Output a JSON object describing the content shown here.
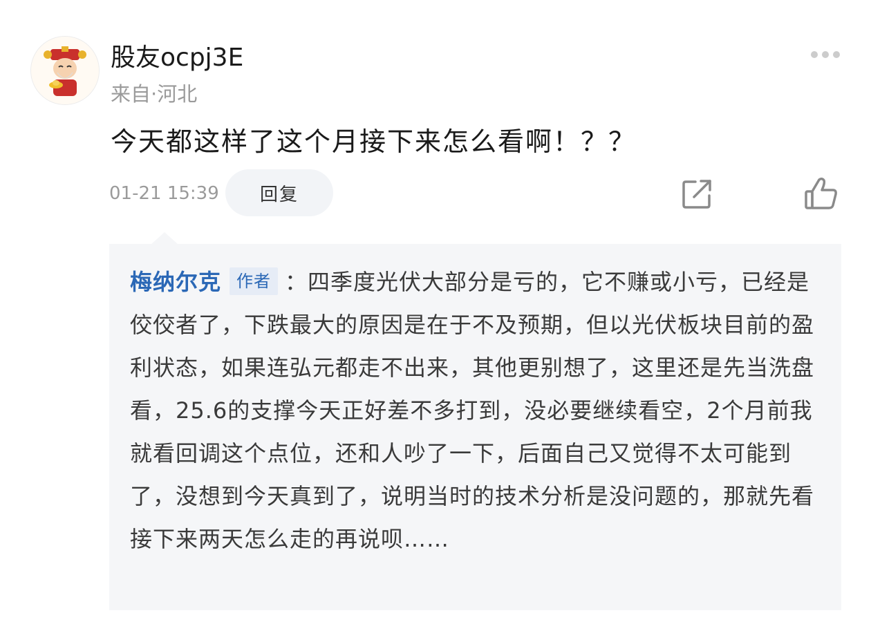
{
  "post": {
    "username": "股友ocpj3E",
    "location": "来自·河北",
    "text": "今天都这样了这个月接下来怎么看啊！？？",
    "timestamp": "01-21 15:39",
    "reply_label": "回复"
  },
  "icons": {
    "avatar": "avatar-image",
    "more": "more-icon",
    "share": "share-icon",
    "like": "like-icon"
  },
  "reply": {
    "author": "梅纳尔克",
    "badge": "作者",
    "separator": "：",
    "text": "四季度光伏大部分是亏的，它不赚或小亏，已经是佼佼者了，下跌最大的原因是在于不及预期，但以光伏板块目前的盈利状态，如果连弘元都走不出来，其他更别想了，这里还是先当洗盘看，25.6的支撑今天正好差不多打到，没必要继续看空，2个月前我就看回调这个点位，还和人吵了一下，后面自己又觉得不太可能到了，没想到今天真到了，说明当时的技术分析是没问题的，那就先看接下来两天怎么走的再说呗……"
  },
  "colors": {
    "author_blue": "#2b68b6",
    "meta_gray": "#9a9a9a",
    "reply_bg": "#f5f6f8"
  }
}
